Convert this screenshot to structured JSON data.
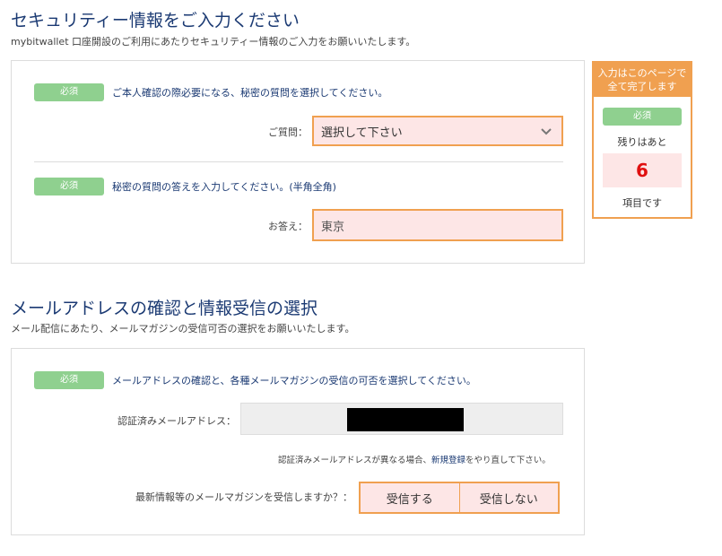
{
  "security": {
    "title": "セキュリティー情報をご入力ください",
    "subtitle": "mybitwallet 口座開設のご利用にあたりセキュリティー情報のご入力をお願いいたします。",
    "question_badge": "必須",
    "question_instruction": "ご本人確認の際必要になる、秘密の質問を選択してください。",
    "question_label": "ご質問：",
    "question_select_value": "選択して下さい",
    "answer_badge": "必須",
    "answer_instruction": "秘密の質問の答えを入力してください。(半角全角)",
    "answer_label": "お答え：",
    "answer_value": "東京"
  },
  "email": {
    "title": "メールアドレスの確認と情報受信の選択",
    "subtitle": "メール配信にあたり、メールマガジンの受信可否の選択をお願いいたします。",
    "badge": "必須",
    "instruction": "メールアドレスの確認と、各種メールマガジンの受信の可否を選択してください。",
    "verified_label": "認証済みメールアドレス：",
    "note_before": "認証済みメールアドレスが異なる場合、",
    "note_link": "新規登録",
    "note_after": "をやり直して下さい。",
    "newsletter_question": "最新情報等のメールマガジンを受信しますか？：",
    "option_receive": "受信する",
    "option_decline": "受信しない"
  },
  "sidebar": {
    "header": "入力はこのページで全て完了します",
    "badge": "必須",
    "remaining_label": "残りはあと",
    "remaining_count": "6",
    "remaining_suffix": "項目です"
  },
  "colors": {
    "accent_orange": "#f0a050",
    "field_pink": "#fde6e6",
    "badge_green": "#8fd08f",
    "title_navy": "#1b3a73",
    "count_red": "#e01010"
  }
}
